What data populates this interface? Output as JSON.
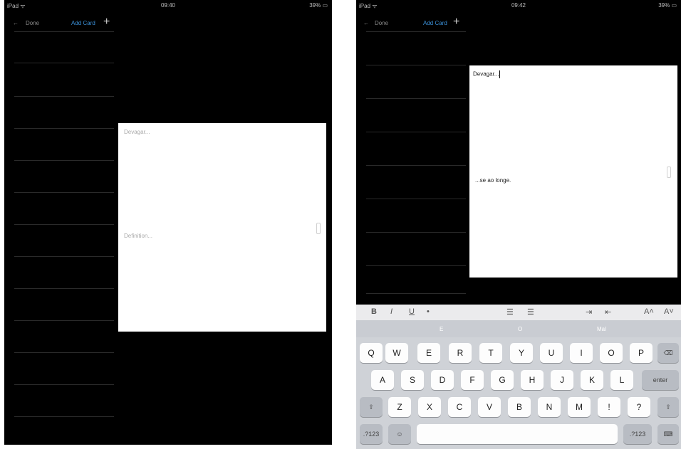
{
  "left_screen": {
    "status": {
      "carrier": "iPad ᯤ",
      "time": "09:40",
      "battery": "39% ▭"
    },
    "nav": {
      "back_label": "Done",
      "add_label": "Add Card",
      "plus": "+"
    },
    "card": {
      "front": "Devagar...",
      "back": "Definition..."
    }
  },
  "right_screen": {
    "status": {
      "carrier": "iPad ᯤ",
      "time": "09:42",
      "battery": "39% ▭"
    },
    "nav": {
      "back_label": "Done",
      "add_label": "Add Card",
      "plus": "+"
    },
    "card": {
      "front": "Devagar...",
      "back": "...se ao longe."
    },
    "format_bar": {
      "bold": "B",
      "italic": "I",
      "underline": "U",
      "bullet": "•",
      "align_1": "☰",
      "align_2": "☰",
      "indent_1": "⇥",
      "indent_2": "⇤",
      "size_up": "A˄",
      "size_down": "A˅"
    },
    "suggestions": [
      "E",
      "O",
      "Mal"
    ],
    "keyboard": {
      "row1": [
        "Q",
        "W",
        "E",
        "R",
        "T",
        "Y",
        "U",
        "I",
        "O",
        "P"
      ],
      "delete": "⌫",
      "row2": [
        "A",
        "S",
        "D",
        "F",
        "G",
        "H",
        "J",
        "K",
        "L"
      ],
      "enter": "enter",
      "shift": "⇧",
      "row3": [
        "Z",
        "X",
        "C",
        "V",
        "B",
        "N",
        "M",
        "!",
        "?"
      ],
      "numbers_left": ".?123",
      "emoji": "☺",
      "numbers_right": ".?123",
      "hide_keyboard": "⌨"
    }
  }
}
